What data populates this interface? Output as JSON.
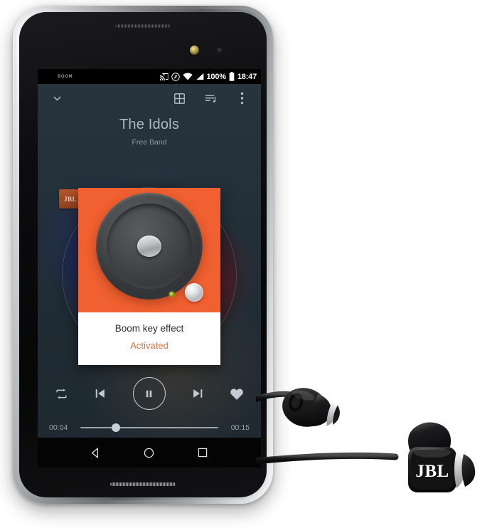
{
  "device": {
    "name": "smartphone",
    "brand_accent": "#f06030"
  },
  "status_bar": {
    "left_label": "BOOM",
    "battery_percent": "100%",
    "time": "18:47",
    "icons": [
      "cast-icon",
      "nfc-icon",
      "wifi-icon",
      "cellular-signal-icon",
      "battery-icon"
    ]
  },
  "toolbar": {
    "collapse_icon": "chevron-down-icon",
    "grid_icon": "grid-view-icon",
    "queue_icon": "playlist-queue-icon",
    "overflow_icon": "overflow-menu-icon"
  },
  "now_playing": {
    "title": "The Idols",
    "artist": "Free Band",
    "badge_label": "JBL"
  },
  "popup": {
    "image_icon": "speaker-woofer-icon",
    "title": "Boom key effect",
    "status": "Activated",
    "status_color": "#e2703c",
    "background_color": "#f06030"
  },
  "controls": {
    "repeat_label": "repeat-icon",
    "previous_label": "previous-track-icon",
    "play_pause_label": "pause-icon",
    "next_label": "next-track-icon",
    "favorite_label": "heart-icon"
  },
  "seek": {
    "elapsed": "00:04",
    "duration": "00:15",
    "progress_percent": 26
  },
  "nav_bar": {
    "back_label": "back-icon",
    "home_label": "home-icon",
    "recents_label": "recents-icon"
  },
  "earphones": {
    "logo": "JBL"
  }
}
